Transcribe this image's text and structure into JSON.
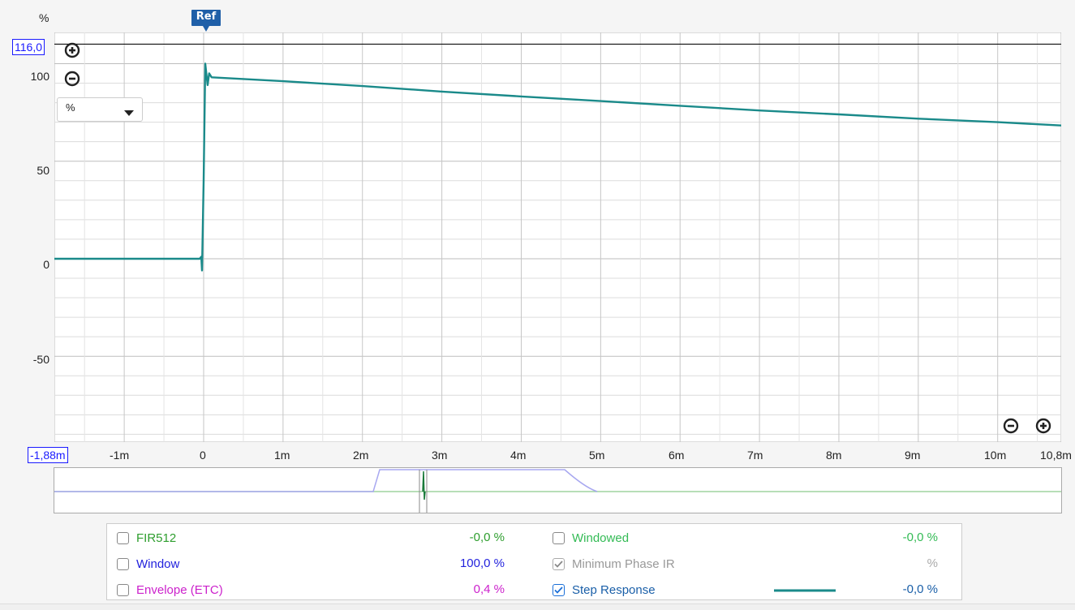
{
  "y_axis": {
    "unit": "%",
    "top_value": "116,0",
    "ticks": [
      "100",
      "50",
      "0",
      "-50"
    ]
  },
  "x_axis": {
    "start_value": "-1,88m",
    "ticks": [
      "-1m",
      "0",
      "1m",
      "2m",
      "3m",
      "4m",
      "5m",
      "6m",
      "7m",
      "8m",
      "9m",
      "10m",
      "10,8m"
    ]
  },
  "ref_marker": "Ref",
  "unit_dropdown": {
    "selected": "%"
  },
  "colors": {
    "trace": "#1a8a8a",
    "grid": "#d4d4d4",
    "hline": "#111111",
    "window": "#9999ee",
    "fir": "#88cc88"
  },
  "chart_data": {
    "type": "line",
    "xlabel": "",
    "ylabel": "%",
    "xlim": [
      -1.88,
      10.8
    ],
    "ylim": [
      -94,
      116
    ],
    "series": [
      {
        "name": "Step Response",
        "x": [
          -1.88,
          -0.05,
          -0.03,
          -0.02,
          0.0,
          0.02,
          0.05,
          0.07,
          0.1,
          1,
          2,
          3,
          4,
          5,
          6,
          7,
          8,
          9,
          10,
          10.8
        ],
        "y": [
          0,
          0,
          1,
          -6,
          40,
          100,
          89,
          95,
          93,
          91,
          88.5,
          85.7,
          83.2,
          80.8,
          78.4,
          76,
          74,
          71.8,
          70,
          68.3
        ]
      }
    ]
  },
  "legend": {
    "items": [
      {
        "label": "FIR512",
        "value": "-0,0 %",
        "checked": false,
        "color": "#2e9e2e"
      },
      {
        "label": "Window",
        "value": "100,0 %",
        "checked": false,
        "color": "#2222dd"
      },
      {
        "label": "Envelope (ETC)",
        "value": "0,4 %",
        "checked": false,
        "color": "#cc22cc"
      },
      {
        "label": "Windowed",
        "value": "-0,0 %",
        "checked": false,
        "color": "#33bb55"
      },
      {
        "label": "Minimum Phase IR",
        "value": "%",
        "checked": true,
        "color": "#999999"
      },
      {
        "label": "Step Response",
        "value": "-0,0 %",
        "checked": true,
        "color": "#1a5fa8"
      }
    ]
  }
}
